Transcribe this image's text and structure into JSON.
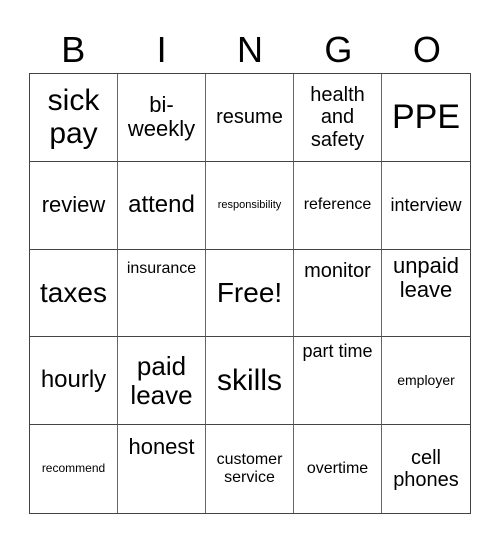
{
  "header": {
    "letters": [
      "B",
      "I",
      "N",
      "G",
      "O"
    ]
  },
  "cells": [
    "sick pay",
    "bi-weekly",
    "resume",
    "health and safety",
    "PPE",
    "review",
    "attend",
    "responsibility",
    "reference",
    "interview",
    "taxes",
    "insurance",
    "Free!",
    "monitor",
    "unpaid leave",
    "hourly",
    "paid leave",
    "skills",
    "part time",
    "employer",
    "recommend",
    "honest",
    "customer service",
    "overtime",
    "cell phones"
  ]
}
